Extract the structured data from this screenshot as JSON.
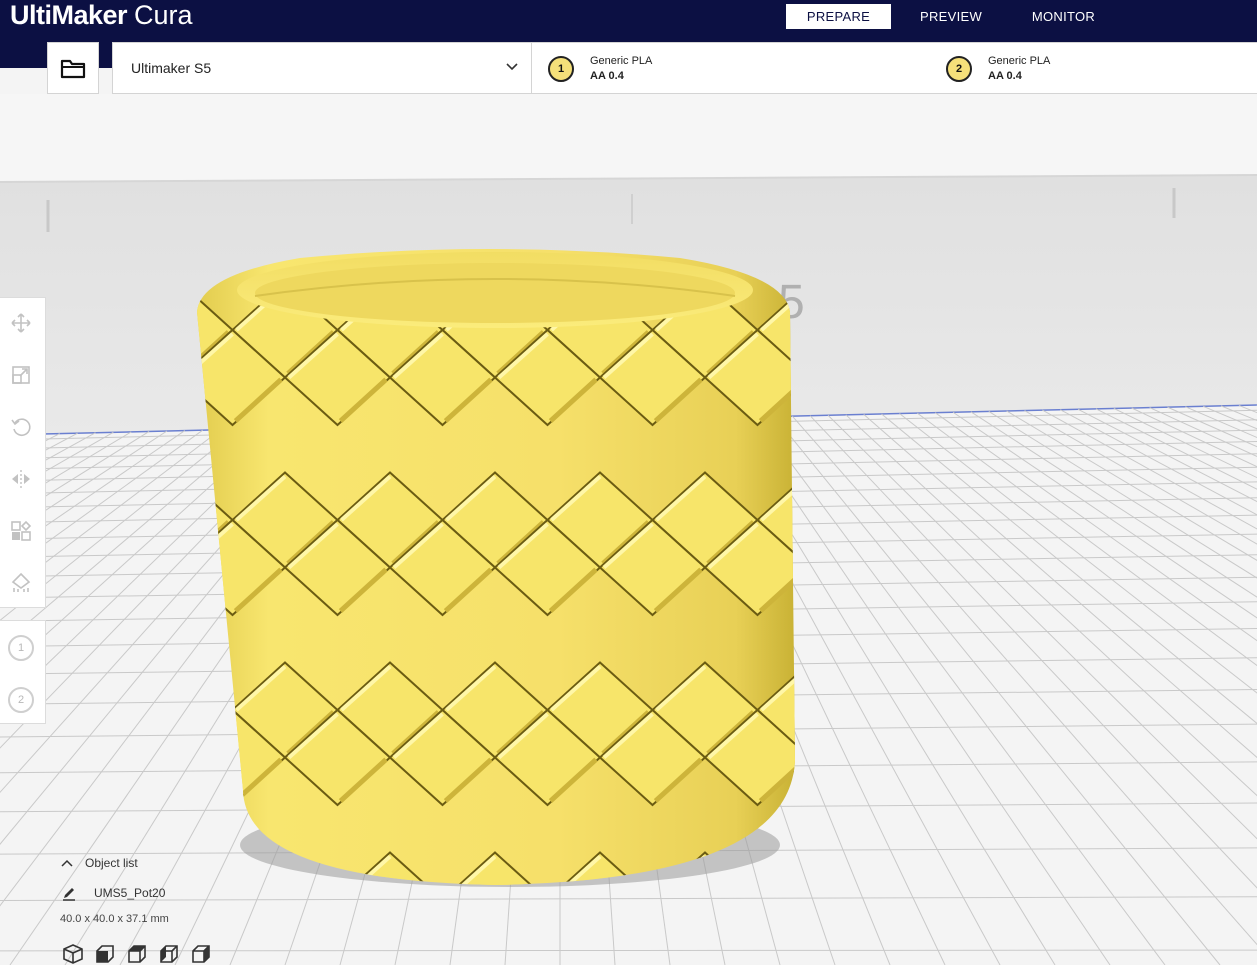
{
  "app": {
    "brand_bold": "UltiMaker",
    "brand_light": "Cura"
  },
  "stages": [
    {
      "label": "PREPARE",
      "active": true
    },
    {
      "label": "PREVIEW",
      "active": false
    },
    {
      "label": "MONITOR",
      "active": false
    }
  ],
  "printer": {
    "name": "Ultimaker S5"
  },
  "extruders": [
    {
      "index": "1",
      "material": "Generic PLA",
      "core": "AA 0.4"
    },
    {
      "index": "2",
      "material": "Generic PLA",
      "core": "AA 0.4"
    }
  ],
  "tools": [
    "move-icon",
    "scale-icon",
    "rotate-icon",
    "mirror-icon",
    "per-model-settings-icon",
    "support-blocker-icon"
  ],
  "extruder_buttons": [
    "1",
    "2"
  ],
  "object_list": {
    "toggle_label": "Object list",
    "object_name": "UMS5_Pot20",
    "dimensions": "40.0 x 40.0 x 37.1 mm"
  },
  "build_plate_label": "5",
  "colors": {
    "topbar": "#0c1043",
    "model": "#f7e56a",
    "model_shade": "#c9b235",
    "grid": "#c6c6c6"
  }
}
